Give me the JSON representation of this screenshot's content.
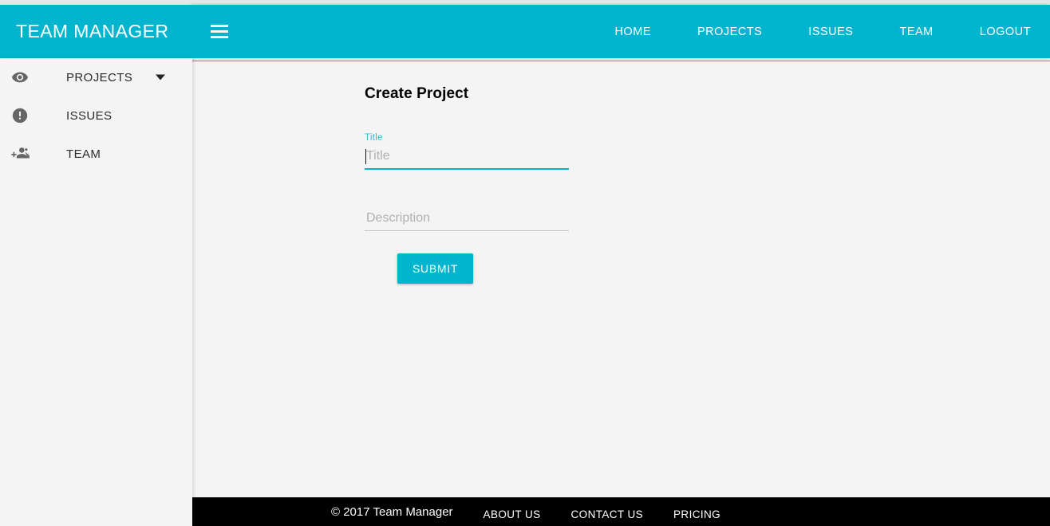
{
  "brand": {
    "title": "TEAM MANAGER"
  },
  "topbar": {
    "menu_icon": "hamburger-icon",
    "links": [
      {
        "label": "HOME"
      },
      {
        "label": "PROJECTS"
      },
      {
        "label": "ISSUES"
      },
      {
        "label": "TEAM"
      },
      {
        "label": "LOGOUT"
      }
    ]
  },
  "sidebar": {
    "items": [
      {
        "label": "PROJECTS",
        "icon": "eye-icon",
        "has_caret": true
      },
      {
        "label": "ISSUES",
        "icon": "error-circle-icon",
        "has_caret": false
      },
      {
        "label": "TEAM",
        "icon": "person-add-icon",
        "has_caret": false
      }
    ]
  },
  "main": {
    "page_title": "Create Project",
    "fields": {
      "title": {
        "label": "Title",
        "placeholder": "Title",
        "value": "",
        "focused": true
      },
      "description": {
        "label": "",
        "placeholder": "Description",
        "value": "",
        "focused": false
      }
    },
    "submit_label": "SUBMIT"
  },
  "footer": {
    "copyright": "© 2017 Team Manager",
    "links": [
      {
        "label": "ABOUT US"
      },
      {
        "label": "CONTACT US"
      },
      {
        "label": "PRICING"
      }
    ]
  },
  "colors": {
    "accent": "#00b5cd",
    "page_bg": "#f4f4f4",
    "footer_bg": "#000000",
    "top_strip": "#e6e6e6",
    "label_accent": "#37b8d0"
  }
}
